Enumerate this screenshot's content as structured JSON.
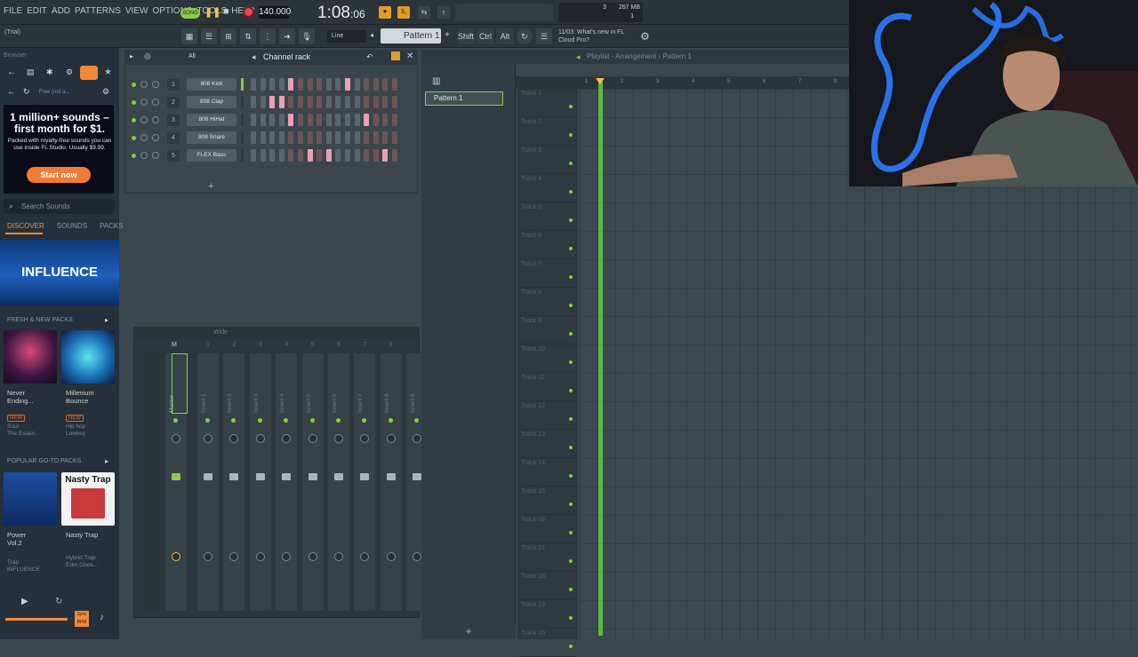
{
  "menu": [
    "FILE",
    "EDIT",
    "ADD",
    "PATTERNS",
    "VIEW",
    "OPTIONS",
    "TOOLS",
    "HELP"
  ],
  "transport": {
    "song_label": "SONG",
    "tempo": "140.000",
    "time_main": "1:08",
    "time_sub": "06",
    "play_icon": "play-pause-icon",
    "stop_icon": "stop-icon"
  },
  "toolbar": {
    "trial": "(Trial)",
    "line_mode": "Line",
    "pattern": "Pattern 1",
    "keys": [
      "Shift",
      "Ctrl",
      "Alt"
    ],
    "news_line1": "11/03: What's new in FL",
    "news_line2": "Cloud Pro?"
  },
  "cpu": {
    "memory": "267 MB",
    "voices": "3",
    "cores": "1"
  },
  "browser": {
    "header": "Browser",
    "free_label": "Free (not a...",
    "ad_title": "1 million+ sounds – first month for $1.",
    "ad_body": "Packed with royalty-free sounds you can use inside FL Studio. Usually $9.99.",
    "ad_button": "Start now",
    "search_placeholder": "Search Sounds",
    "tabs": [
      "DISCOVER",
      "SOUNDS",
      "PACKS"
    ],
    "banner": "INFLUENCE",
    "section1": "FRESH & NEW PACKS",
    "section2": "POPULAR GO-TO PACKS",
    "packs_new": [
      {
        "title1": "Never",
        "title2": "Ending...",
        "badge": "NEW",
        "genre": "Soul",
        "author": "The Essen..."
      },
      {
        "title1": "Millenium",
        "title2": "Bounce",
        "badge": "NEW",
        "genre": "Hip hop",
        "author": "Lowkey"
      }
    ],
    "packs_popular": [
      {
        "title1": "Power",
        "title2": "Vol.2",
        "genre": "Trap",
        "author": "INFLUENCE"
      },
      {
        "title1": "Nasty Trap",
        "title2": "",
        "genre": "Hybrid Trap",
        "author": "Edm Ghos..."
      }
    ],
    "nasty_art": "Nasty Trap",
    "footer_bpm": "Sync BPM"
  },
  "channel_rack": {
    "title": "Channel rack",
    "filter": "All",
    "channels": [
      {
        "num": "1",
        "name": "808 Kick"
      },
      {
        "num": "2",
        "name": "808 Clap"
      },
      {
        "num": "3",
        "name": "808 HiHat"
      },
      {
        "num": "4",
        "name": "808 Snare"
      },
      {
        "num": "5",
        "name": "FLEX Bass"
      }
    ],
    "add_label": "+"
  },
  "mixer": {
    "preset": "Wide",
    "master": "Master",
    "inserts": [
      "Insert 1",
      "Insert 2",
      "Insert 3",
      "Insert 4",
      "Insert 5",
      "Insert 6",
      "Insert 7",
      "Insert 8",
      "Insert 9"
    ],
    "strip_numbers": [
      "M",
      "1",
      "2",
      "3",
      "4",
      "5",
      "6",
      "7",
      "8"
    ]
  },
  "playlist": {
    "title": "Playlist - Arrangement › Pattern 1",
    "pattern_item": "Pattern 1",
    "bars": [
      "1",
      "2",
      "3",
      "4",
      "5",
      "6",
      "7",
      "8"
    ],
    "tracks": [
      "Track 1",
      "Track 2",
      "Track 3",
      "Track 4",
      "Track 5",
      "Track 6",
      "Track 7",
      "Track 8",
      "Track 9",
      "Track 10",
      "Track 11",
      "Track 12",
      "Track 13",
      "Track 14",
      "Track 15",
      "Track 16",
      "Track 17",
      "Track 18",
      "Track 19",
      "Track 20"
    ],
    "add_label": "+"
  },
  "colors": {
    "accent": "#f08a3a",
    "green": "#7fd13a",
    "step_on": "#e8a1b4",
    "step_off": "#5a666c"
  }
}
